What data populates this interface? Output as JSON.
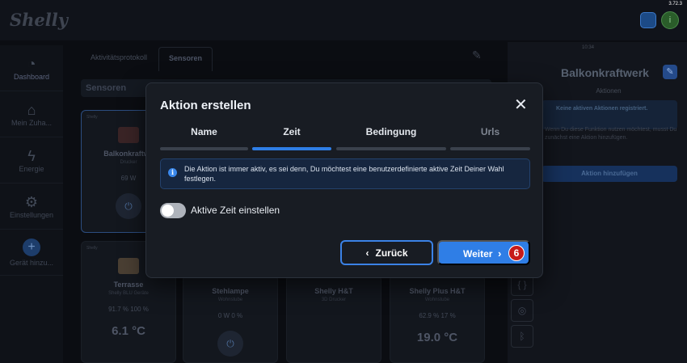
{
  "app": {
    "logo": "Shelly",
    "version": "3.72.3",
    "avatar_letter": "i"
  },
  "sidebar": {
    "items": [
      {
        "label": "Dashboard",
        "icon": "dashboard-icon"
      },
      {
        "label": "Mein Zuha...",
        "icon": "home-icon"
      },
      {
        "label": "Energie",
        "icon": "lightning-icon"
      },
      {
        "label": "Einstellungen",
        "icon": "gear-icon"
      },
      {
        "label": "Gerät hinzu...",
        "icon": "plus-icon"
      }
    ]
  },
  "main": {
    "tabs": [
      {
        "label": "Aktivitätsprotokoll"
      },
      {
        "label": "Sensoren"
      }
    ],
    "section_title": "Sensoren",
    "cards": [
      {
        "brand": "Shelly",
        "name": "Balkonkraftwe",
        "room": "Drucker",
        "stats": "69 W",
        "temp": ""
      },
      {
        "brand": "Shelly",
        "name": "Terrasse",
        "room": "Shelly BLU Geräte",
        "stats": "91.7 %   100 %",
        "temp": "6.1 °C"
      },
      {
        "brand": "",
        "name": "Stehlampe",
        "room": "Wohnstube",
        "stats": "0 W   0 %",
        "temp": ""
      },
      {
        "brand": "",
        "name": "Shelly H&T",
        "room": "3D Drucker",
        "stats": "",
        "temp": ""
      },
      {
        "brand": "",
        "name": "Shelly Plus H&T",
        "room": "Wohnstube",
        "stats": "62.9 %   17 %",
        "temp": "19.0 °C"
      }
    ]
  },
  "right_panel": {
    "time": "10:34",
    "title": "Balkonkraftwerk",
    "subtitle": "Aktionen",
    "info_title": "Keine aktiven Aktionen registriert.",
    "info_text": "Wenn Du diese Funktion nutzen möchtest, musst Du zunächst eine Aktion hinzufügen.",
    "button": "Aktion hinzufügen"
  },
  "dialog": {
    "title": "Aktion erstellen",
    "steps": [
      {
        "label": "Name",
        "state": "done"
      },
      {
        "label": "Zeit",
        "state": "current"
      },
      {
        "label": "Bedingung",
        "state": "todo"
      },
      {
        "label": "Urls",
        "state": "disabled"
      }
    ],
    "info": "Die Aktion ist immer aktiv, es sei denn, Du möchtest eine benutzerdefinierte aktive Zeit Deiner Wahl festlegen.",
    "toggle_label": "Aktive Zeit einstellen",
    "toggle_on": false,
    "back_label": "Zurück",
    "next_label": "Weiter",
    "badge": "6"
  },
  "colors": {
    "accent": "#2f7ee6",
    "dialog_bg": "#181c23",
    "page_bg": "#0b0d12",
    "badge": "#c61a1a"
  }
}
